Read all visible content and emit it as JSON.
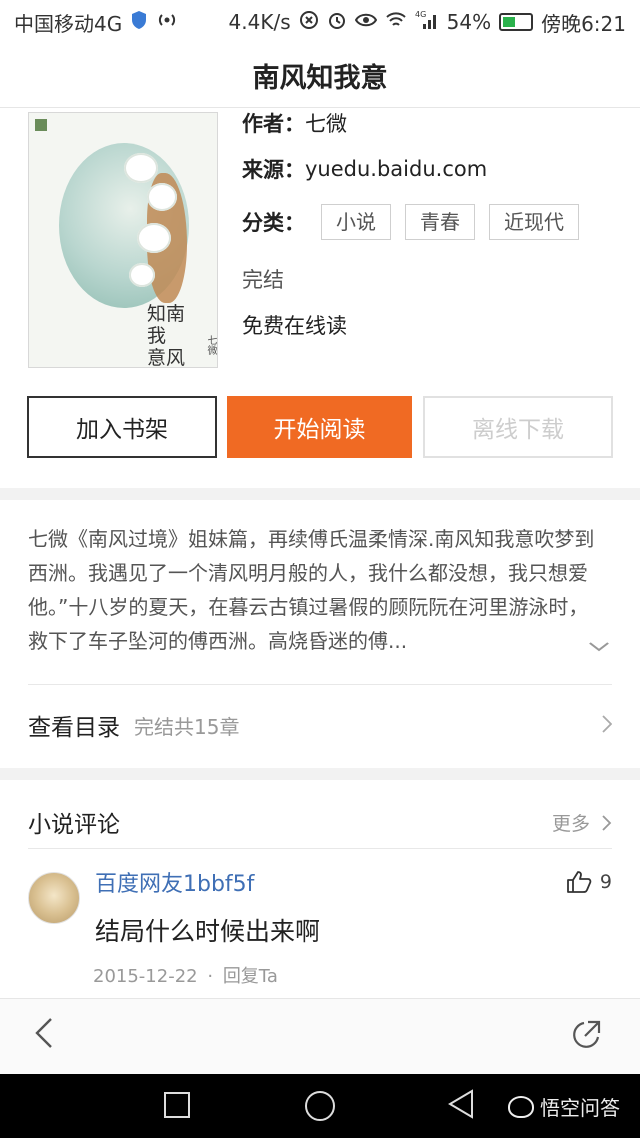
{
  "status_bar": {
    "carrier": "中国移动4G",
    "speed": "4.4K/s",
    "signal_label": "4G",
    "battery_pct": "54%",
    "battery_level": 0.54,
    "time": "傍晚6:21"
  },
  "nav": {
    "title": "南风知我意"
  },
  "cover": {
    "title_lines": [
      "知南",
      "我",
      "意风"
    ],
    "author_small": "七微"
  },
  "book": {
    "author_key": "作者：",
    "author": "七微",
    "source_key": "来源：",
    "source": "yuedu.baidu.com",
    "category_key": "分类：",
    "tags": [
      "小说",
      "青春",
      "近现代"
    ],
    "status": "完结",
    "price": "免费在线读"
  },
  "actions": {
    "add_shelf": "加入书架",
    "start_read": "开始阅读",
    "offline": "离线下载"
  },
  "description": "七微《南风过境》姐妹篇，再续傅氏温柔情深.南风知我意吹梦到西洲。我遇见了一个清风明月般的人，我什么都没想，我只想爱他。”十八岁的夏天，在暮云古镇过暑假的顾阮阮在河里游泳时，救下了车子坠河的傅西洲。高烧昏迷的傅...",
  "toc": {
    "label": "查看目录",
    "count": "完结共15章"
  },
  "comments": {
    "title": "小说评论",
    "more": "更多",
    "items": [
      {
        "user": "百度网友1bbf5f",
        "likes": "9",
        "text": "结局什么时候出来啊",
        "date": "2015-12-22",
        "reply": "回复Ta"
      }
    ]
  },
  "watermark": "悟空问答"
}
